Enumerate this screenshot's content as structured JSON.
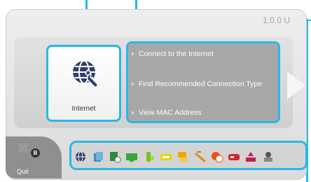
{
  "header": {
    "version": "1.0.0 U"
  },
  "selected_category": {
    "label": "Internet",
    "icon": "globe-wrench-icon"
  },
  "menu": {
    "items": [
      {
        "label": "Connect to the Internet"
      },
      {
        "label": "Find Recommended Connection Type"
      },
      {
        "label": "View MAC Address"
      }
    ]
  },
  "quit": {
    "button": "B",
    "label": "Quit"
  },
  "tray": {
    "icons": [
      "internet-icon",
      "data-management-icon",
      "date-time-icon",
      "tv-icon",
      "power-icon",
      "sensor-bar-icon",
      "parental-controls-icon",
      "tools-icon",
      "language-icon",
      "console-icon",
      "system-update-icon",
      "user-icon"
    ]
  },
  "colors": {
    "accent": "#29b8e5",
    "panel": "#d8d8d8",
    "menu_bg": "#a8a8a8"
  }
}
